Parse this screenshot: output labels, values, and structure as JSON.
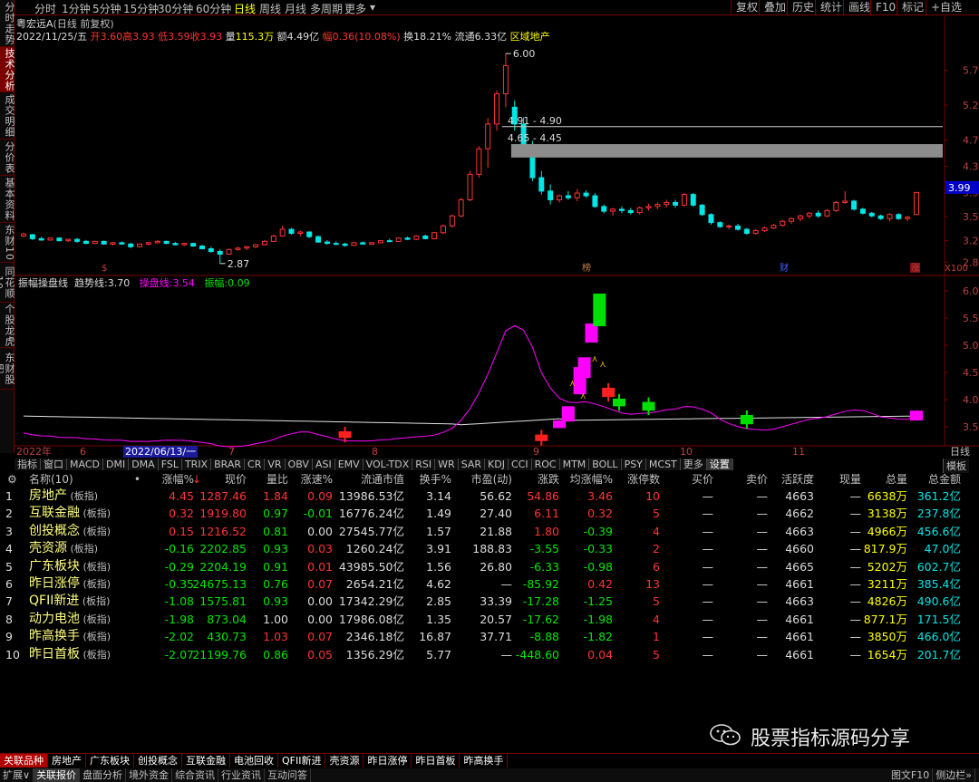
{
  "side_tabs": [
    "分时走势",
    "技术分析",
    "成交明细",
    "分价表",
    "基本资料",
    "东财10",
    "同花顺10",
    "个股龙虎",
    "东财股吧"
  ],
  "side_active": 1,
  "periods": [
    "分时",
    "1分钟",
    "5分钟",
    "15分钟",
    "30分钟",
    "60分钟",
    "日线",
    "周线",
    "月线",
    "多周期",
    "更多"
  ],
  "period_active": "日线",
  "right_buttons": [
    "复权",
    "叠加",
    "历史",
    "统计",
    "画线",
    "F10",
    "标记",
    "+自选"
  ],
  "stock": {
    "title": "粤宏远A",
    "subtitle": "(日线 前复权)",
    "date": "2022/11/25/五",
    "open_label": "开",
    "open": "3.60",
    "high_label": "高",
    "high": "3.93",
    "low_label": "低",
    "low": "3.59",
    "close_label": "收",
    "close": "3.93",
    "vol_label": "量",
    "vol": "115.3万",
    "amount_label": "额",
    "amount": "4.49亿",
    "chg_label": "幅",
    "chg": "0.36(10.08%)",
    "turnover_label": "换",
    "turnover": "18.21%",
    "float_label": "流通",
    "float": "6.33亿",
    "sector": "区域地产"
  },
  "price_axis": [
    "5.75",
    "5.23",
    "4.71",
    "4.32",
    "3.93",
    "3.57",
    "3.21",
    "2.89"
  ],
  "price_current": "3.99",
  "annotations": {
    "high": "6.00",
    "low": "2.87",
    "zone1": "4.91 - 4.90",
    "zone2": "4.65 - 4.45"
  },
  "markers": [
    "$",
    "榜",
    "财",
    "涨"
  ],
  "x100": "X100",
  "indicator": {
    "name": "振幅操盘线",
    "trend_label": "趋势线:",
    "trend": "3.70",
    "op_label": "操盘线:",
    "op": "3.54",
    "amp_label": "振幅:",
    "amp": "0.09"
  },
  "ind_axis": [
    "6.00",
    "5.50",
    "5.00",
    "4.50",
    "4.00",
    "3.50"
  ],
  "date_axis": {
    "year": "2022年",
    "months": [
      "6",
      "7",
      "8",
      "9",
      "10",
      "11"
    ],
    "cursor": "2022/06/13/一",
    "right": "日线"
  },
  "indicator_tabs": [
    "指标",
    "窗口",
    "MACD",
    "DMI",
    "DMA",
    "FSL",
    "TRIX",
    "BRAR",
    "CR",
    "VR",
    "OBV",
    "ASI",
    "EMV",
    "VOL-TDX",
    "RSI",
    "WR",
    "SAR",
    "KDJ",
    "CCI",
    "ROC",
    "MTM",
    "BOLL",
    "PSY",
    "MCST",
    "更多",
    "设置"
  ],
  "indicator_tab_active": "设置",
  "template_label": "模板",
  "table": {
    "columns": [
      "名称(10)",
      "•",
      "涨幅%",
      "现价",
      "量比",
      "涨速%",
      "流通市值",
      "换手%",
      "市盈(动)",
      "涨跌",
      "均涨幅%",
      "涨停数",
      "买价",
      "卖价",
      "活跃度",
      "现量",
      "总量",
      "总金额"
    ],
    "sort_marker": "↓",
    "tag": "(板指)",
    "rows": [
      {
        "n": "1",
        "name": "房地产",
        "chg": "4.45",
        "price": "1287.46",
        "ratio": "1.84",
        "speed": "0.09",
        "mcap": "13986.53亿",
        "turn": "3.14",
        "pe": "56.62",
        "diff": "54.86",
        "avg": "3.46",
        "limit": "10",
        "bid": "—",
        "ask": "—",
        "act": "4663",
        "cur": "—",
        "vol": "6638万",
        "amt": "361.2亿",
        "up": "up",
        "ratioup": "up",
        "speedup": "up",
        "avgup": "up"
      },
      {
        "n": "2",
        "name": "互联金融",
        "chg": "0.32",
        "price": "1919.80",
        "ratio": "0.97",
        "speed": "-0.01",
        "mcap": "16776.24亿",
        "turn": "1.49",
        "pe": "27.40",
        "diff": "6.11",
        "avg": "0.32",
        "limit": "5",
        "bid": "—",
        "ask": "—",
        "act": "4662",
        "cur": "—",
        "vol": "3138万",
        "amt": "237.8亿",
        "up": "up",
        "ratioup": "dn",
        "speedup": "dn",
        "avgup": "up"
      },
      {
        "n": "3",
        "name": "创投概念",
        "chg": "0.15",
        "price": "1216.52",
        "ratio": "0.81",
        "speed": "0.00",
        "mcap": "27545.77亿",
        "turn": "1.57",
        "pe": "21.88",
        "diff": "1.80",
        "avg": "-0.39",
        "limit": "4",
        "bid": "—",
        "ask": "—",
        "act": "4663",
        "cur": "—",
        "vol": "4966万",
        "amt": "456.6亿",
        "up": "up",
        "ratioup": "dn",
        "speedup": "eq",
        "avgup": "dn"
      },
      {
        "n": "4",
        "name": "壳资源",
        "chg": "-0.16",
        "price": "2202.85",
        "ratio": "0.93",
        "speed": "0.03",
        "mcap": "1260.24亿",
        "turn": "3.91",
        "pe": "188.83",
        "diff": "-3.55",
        "avg": "-0.33",
        "limit": "2",
        "bid": "—",
        "ask": "—",
        "act": "4660",
        "cur": "—",
        "vol": "817.9万",
        "amt": "47.0亿",
        "up": "dn",
        "ratioup": "dn",
        "speedup": "up",
        "avgup": "dn"
      },
      {
        "n": "5",
        "name": "广东板块",
        "chg": "-0.29",
        "price": "2204.19",
        "ratio": "0.91",
        "speed": "0.01",
        "mcap": "43985.50亿",
        "turn": "1.56",
        "pe": "26.80",
        "diff": "-6.33",
        "avg": "-0.98",
        "limit": "6",
        "bid": "—",
        "ask": "—",
        "act": "4665",
        "cur": "—",
        "vol": "5202万",
        "amt": "602.7亿",
        "up": "dn",
        "ratioup": "dn",
        "speedup": "up",
        "avgup": "dn"
      },
      {
        "n": "6",
        "name": "昨日涨停",
        "chg": "-0.35",
        "price": "24675.13",
        "ratio": "0.76",
        "speed": "0.07",
        "mcap": "2654.21亿",
        "turn": "4.62",
        "pe": "—",
        "diff": "-85.92",
        "avg": "0.42",
        "limit": "13",
        "bid": "—",
        "ask": "—",
        "act": "4661",
        "cur": "—",
        "vol": "3211万",
        "amt": "385.4亿",
        "up": "dn",
        "ratioup": "dn",
        "speedup": "up",
        "avgup": "up"
      },
      {
        "n": "7",
        "name": "QFII新进",
        "chg": "-1.08",
        "price": "1575.81",
        "ratio": "0.93",
        "speed": "0.00",
        "mcap": "17342.29亿",
        "turn": "2.85",
        "pe": "33.39",
        "diff": "-17.28",
        "avg": "-1.25",
        "limit": "5",
        "bid": "—",
        "ask": "—",
        "act": "4663",
        "cur": "—",
        "vol": "4826万",
        "amt": "490.6亿",
        "up": "dn",
        "ratioup": "dn",
        "speedup": "eq",
        "avgup": "dn"
      },
      {
        "n": "8",
        "name": "动力电池",
        "chg": "-1.98",
        "price": "873.04",
        "ratio": "1.00",
        "speed": "0.00",
        "mcap": "17986.08亿",
        "turn": "1.35",
        "pe": "20.57",
        "diff": "-17.62",
        "avg": "-1.98",
        "limit": "4",
        "bid": "—",
        "ask": "—",
        "act": "4661",
        "cur": "—",
        "vol": "877.1万",
        "amt": "171.5亿",
        "up": "dn",
        "ratioup": "eq",
        "speedup": "eq",
        "avgup": "dn"
      },
      {
        "n": "9",
        "name": "昨高换手",
        "chg": "-2.02",
        "price": "430.73",
        "ratio": "1.03",
        "speed": "0.07",
        "mcap": "2346.18亿",
        "turn": "16.87",
        "pe": "37.71",
        "diff": "-8.88",
        "avg": "-1.82",
        "limit": "1",
        "bid": "—",
        "ask": "—",
        "act": "4661",
        "cur": "—",
        "vol": "3850万",
        "amt": "466.0亿",
        "up": "dn",
        "ratioup": "up",
        "speedup": "up",
        "avgup": "dn"
      },
      {
        "n": "10",
        "name": "昨日首板",
        "chg": "-2.07",
        "price": "21199.76",
        "ratio": "0.86",
        "speed": "0.05",
        "mcap": "1356.29亿",
        "turn": "5.77",
        "pe": "—",
        "diff": "-448.60",
        "avg": "0.04",
        "limit": "5",
        "bid": "—",
        "ask": "—",
        "act": "4661",
        "cur": "—",
        "vol": "1654万",
        "amt": "201.7亿",
        "up": "dn",
        "ratioup": "dn",
        "speedup": "up",
        "avgup": "up"
      }
    ]
  },
  "watermark": "股票指标源码分享",
  "bottom_tabs": [
    "关联品种",
    "房地产",
    "互联金融",
    "创投概念",
    "互联金融",
    "电池回收",
    "QFII新进",
    "壳资源",
    "昨日涨停",
    "昨日首板",
    "昨高换手"
  ],
  "bottom_tabs_alt": [
    "关联品种",
    "房地产",
    "广东板块",
    "创投概念",
    "互联金融",
    "电池回收",
    "QFII新进",
    "壳资源",
    "昨日涨停",
    "昨日首板",
    "昨高换手"
  ],
  "bottom_tab_active": 0,
  "status_tabs": [
    "扩展∨",
    "关联报价",
    "盘面分析",
    "境外资金",
    "综合资讯",
    "行业资讯",
    "互动问答"
  ],
  "status_right": [
    "图文F10",
    "侧边栏»"
  ],
  "colors": {
    "up": "#ff3333",
    "down": "#00e600",
    "magenta": "#ff00ff",
    "accent_red": "#7a0000",
    "candle_up": "#ff3333",
    "candle_down": "#00e5e5",
    "zone": "#8c8c8c"
  },
  "candles": {
    "note_values": "daily OHLC values read from chart",
    "ohlc": [
      [
        3.28,
        3.33,
        3.26,
        3.31
      ],
      [
        3.3,
        3.31,
        3.22,
        3.24
      ],
      [
        3.24,
        3.27,
        3.21,
        3.22
      ],
      [
        3.22,
        3.26,
        3.21,
        3.25
      ],
      [
        3.25,
        3.26,
        3.2,
        3.21
      ],
      [
        3.21,
        3.24,
        3.19,
        3.23
      ],
      [
        3.23,
        3.25,
        3.18,
        3.2
      ],
      [
        3.2,
        3.22,
        3.16,
        3.17
      ],
      [
        3.17,
        3.21,
        3.16,
        3.2
      ],
      [
        3.2,
        3.21,
        3.15,
        3.16
      ],
      [
        3.16,
        3.19,
        3.14,
        3.18
      ],
      [
        3.18,
        3.2,
        3.15,
        3.16
      ],
      [
        3.16,
        3.18,
        3.1,
        3.12
      ],
      [
        3.12,
        3.17,
        3.11,
        3.16
      ],
      [
        3.16,
        3.19,
        3.14,
        3.18
      ],
      [
        3.18,
        3.22,
        3.17,
        3.2
      ],
      [
        3.2,
        3.21,
        3.16,
        3.17
      ],
      [
        3.17,
        3.19,
        3.14,
        3.15
      ],
      [
        3.15,
        3.18,
        3.13,
        3.17
      ],
      [
        3.17,
        3.18,
        3.12,
        3.13
      ],
      [
        3.13,
        3.15,
        3.08,
        3.09
      ],
      [
        3.09,
        3.12,
        3.03,
        3.05
      ],
      [
        3.05,
        3.08,
        2.87,
        3.01
      ],
      [
        3.01,
        3.09,
        3.0,
        3.08
      ],
      [
        3.08,
        3.12,
        3.06,
        3.1
      ],
      [
        3.1,
        3.13,
        3.07,
        3.12
      ],
      [
        3.12,
        3.16,
        3.1,
        3.15
      ],
      [
        3.15,
        3.22,
        3.14,
        3.2
      ],
      [
        3.2,
        3.3,
        3.19,
        3.28
      ],
      [
        3.28,
        3.43,
        3.27,
        3.38
      ],
      [
        3.38,
        3.4,
        3.3,
        3.32
      ],
      [
        3.32,
        3.36,
        3.28,
        3.34
      ],
      [
        3.34,
        3.35,
        3.25,
        3.27
      ],
      [
        3.27,
        3.29,
        3.18,
        3.19
      ],
      [
        3.19,
        3.22,
        3.15,
        3.17
      ],
      [
        3.17,
        3.2,
        3.14,
        3.16
      ],
      [
        3.16,
        3.18,
        3.12,
        3.14
      ],
      [
        3.14,
        3.19,
        3.13,
        3.18
      ],
      [
        3.18,
        3.2,
        3.15,
        3.16
      ],
      [
        3.16,
        3.19,
        3.15,
        3.18
      ],
      [
        3.18,
        3.22,
        3.17,
        3.21
      ],
      [
        3.21,
        3.24,
        3.19,
        3.2
      ],
      [
        3.2,
        3.26,
        3.19,
        3.25
      ],
      [
        3.25,
        3.27,
        3.22,
        3.23
      ],
      [
        3.23,
        3.29,
        3.22,
        3.28
      ],
      [
        3.28,
        3.3,
        3.23,
        3.24
      ],
      [
        3.24,
        3.34,
        3.23,
        3.33
      ],
      [
        3.33,
        3.45,
        3.31,
        3.43
      ],
      [
        3.43,
        3.6,
        3.41,
        3.58
      ],
      [
        3.58,
        3.85,
        3.56,
        3.82
      ],
      [
        3.82,
        4.25,
        3.8,
        4.2
      ],
      [
        4.2,
        4.62,
        4.15,
        4.58
      ],
      [
        4.58,
        5.04,
        4.3,
        4.95
      ],
      [
        4.95,
        5.45,
        4.85,
        5.4
      ],
      [
        5.4,
        6.0,
        5.2,
        5.82
      ],
      [
        5.2,
        5.3,
        4.85,
        4.95
      ],
      [
        4.95,
        5.05,
        4.55,
        4.62
      ],
      [
        4.62,
        4.7,
        4.1,
        4.15
      ],
      [
        4.15,
        4.25,
        3.9,
        3.95
      ],
      [
        3.95,
        4.05,
        3.75,
        3.82
      ],
      [
        3.82,
        3.9,
        3.78,
        3.88
      ],
      [
        3.88,
        3.95,
        3.82,
        3.85
      ],
      [
        3.85,
        3.98,
        3.8,
        3.92
      ],
      [
        3.92,
        3.96,
        3.85,
        3.88
      ],
      [
        3.88,
        3.92,
        3.7,
        3.72
      ],
      [
        3.72,
        3.75,
        3.62,
        3.65
      ],
      [
        3.65,
        3.7,
        3.58,
        3.68
      ],
      [
        3.68,
        3.72,
        3.62,
        3.66
      ],
      [
        3.66,
        3.7,
        3.6,
        3.63
      ],
      [
        3.63,
        3.72,
        3.6,
        3.7
      ],
      [
        3.7,
        3.76,
        3.66,
        3.72
      ],
      [
        3.72,
        3.78,
        3.68,
        3.75
      ],
      [
        3.75,
        3.82,
        3.7,
        3.78
      ],
      [
        3.78,
        3.82,
        3.7,
        3.74
      ],
      [
        3.74,
        3.92,
        3.72,
        3.9
      ],
      [
        3.9,
        3.92,
        3.72,
        3.74
      ],
      [
        3.74,
        3.76,
        3.58,
        3.6
      ],
      [
        3.6,
        3.62,
        3.45,
        3.48
      ],
      [
        3.48,
        3.5,
        3.4,
        3.42
      ],
      [
        3.42,
        3.45,
        3.38,
        3.43
      ],
      [
        3.43,
        3.46,
        3.36,
        3.38
      ],
      [
        3.38,
        3.4,
        3.3,
        3.32
      ],
      [
        3.32,
        3.38,
        3.3,
        3.36
      ],
      [
        3.36,
        3.42,
        3.34,
        3.4
      ],
      [
        3.4,
        3.46,
        3.38,
        3.44
      ],
      [
        3.44,
        3.52,
        3.42,
        3.5
      ],
      [
        3.5,
        3.56,
        3.46,
        3.54
      ],
      [
        3.54,
        3.6,
        3.5,
        3.58
      ],
      [
        3.58,
        3.64,
        3.54,
        3.62
      ],
      [
        3.62,
        3.66,
        3.55,
        3.58
      ],
      [
        3.58,
        3.68,
        3.56,
        3.66
      ],
      [
        3.66,
        3.8,
        3.64,
        3.78
      ],
      [
        3.78,
        3.95,
        3.76,
        3.8
      ],
      [
        3.8,
        3.82,
        3.66,
        3.68
      ],
      [
        3.68,
        3.7,
        3.6,
        3.62
      ],
      [
        3.62,
        3.64,
        3.56,
        3.58
      ],
      [
        3.58,
        3.6,
        3.52,
        3.54
      ],
      [
        3.54,
        3.62,
        3.5,
        3.6
      ],
      [
        3.6,
        3.62,
        3.52,
        3.54
      ],
      [
        3.54,
        3.58,
        3.5,
        3.56
      ],
      [
        3.6,
        3.93,
        3.59,
        3.93
      ]
    ]
  }
}
